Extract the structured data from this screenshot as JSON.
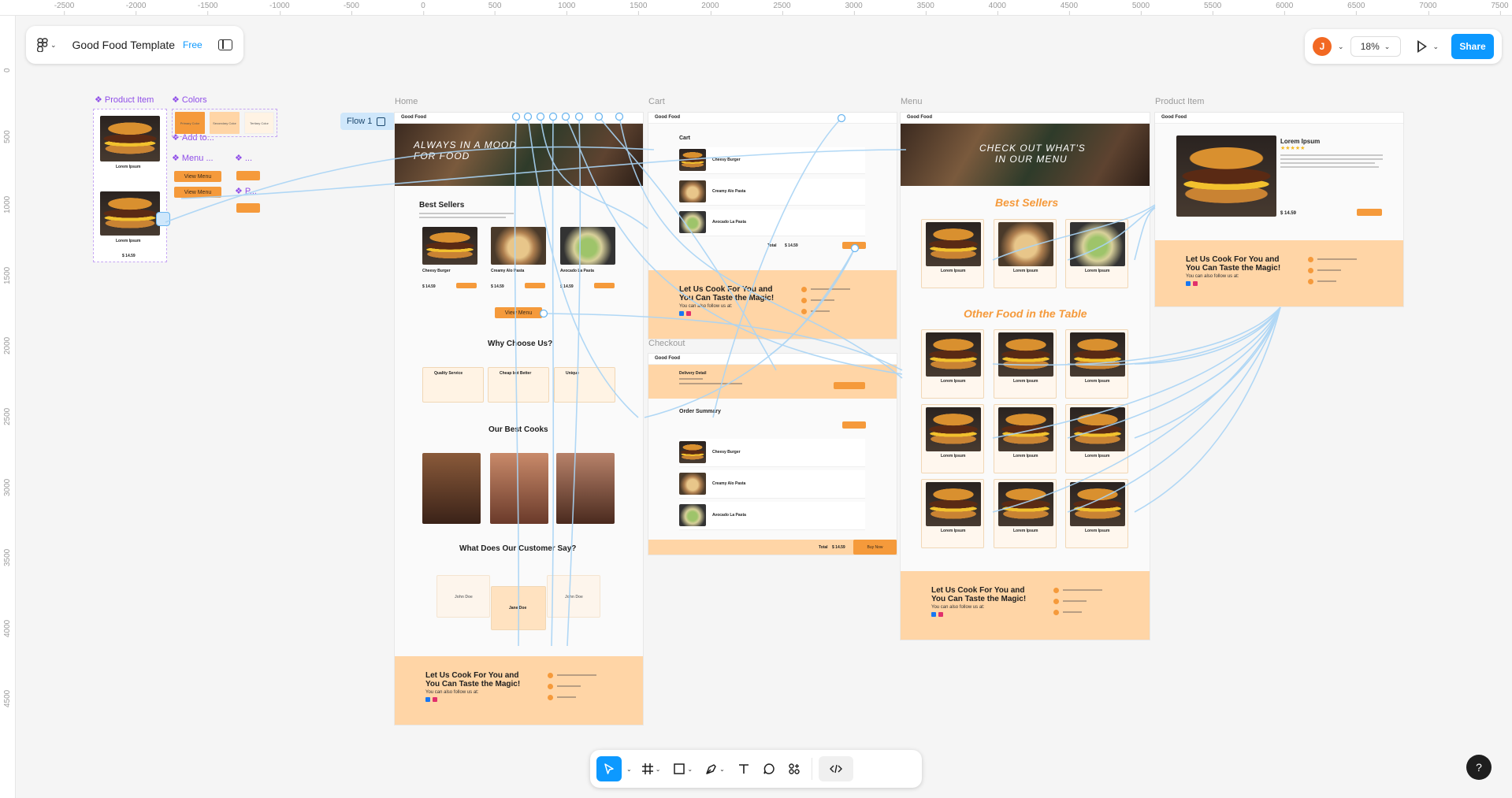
{
  "rulers": {
    "top": [
      "-2500",
      "-2000",
      "-1500",
      "-1000",
      "-500",
      "0",
      "500",
      "1000",
      "1500",
      "2000",
      "2500",
      "3000",
      "3500",
      "4000",
      "4500",
      "5000",
      "5500",
      "6000",
      "6500",
      "7000",
      "7500"
    ],
    "left": [
      "0",
      "500",
      "1000",
      "1500",
      "2000",
      "2500",
      "3000",
      "3500",
      "4000",
      "4500"
    ]
  },
  "file": {
    "title": "Good Food Template",
    "plan_badge": "Free"
  },
  "user": {
    "initial": "J"
  },
  "zoom": {
    "label": "18%"
  },
  "share": {
    "label": "Share"
  },
  "flow": {
    "label": "Flow 1"
  },
  "components": {
    "product_item": "Product Item",
    "colors": "Colors",
    "add_to": "Add to...",
    "menu": "Menu ...",
    "more": "...",
    "p": "P...",
    "swatches": [
      "Primary Color",
      "Secondary Color",
      "Tertiary Color"
    ],
    "view_menu_1": "View Menu",
    "view_menu_2": "View Menu",
    "lorem": "Lorem Ipsum",
    "price": "$ 14.59"
  },
  "frames": {
    "home": {
      "label": "Home",
      "brand": "Good Food",
      "hero_line1": "ALWAYS IN A MOOD",
      "hero_line2": "FOR FOOD",
      "best_sellers": "Best Sellers",
      "items": [
        "Cheesy Burger",
        "Creamy Alo Pasta",
        "Avocado La Pasta"
      ],
      "prices": [
        "$ 14.59",
        "$ 14.59",
        "$ 14.59"
      ],
      "view_menu": "View Menu",
      "why_title": "Why Choose Us?",
      "why_cards": [
        "Quality Service",
        "Cheap but Better",
        "Unique"
      ],
      "cooks_title": "Our Best Cooks",
      "testimonials_title": "What Does Our Customer Say?",
      "reviewers": [
        "John Doe",
        "Jane Doe",
        "John Doe"
      ],
      "cta_line1": "Let Us Cook For You and",
      "cta_line2": "You Can Taste the Magic!",
      "follow": "You can also follow us at:"
    },
    "cart": {
      "label": "Cart",
      "brand": "Good Food",
      "title": "Cart",
      "items": [
        "Cheesy Burger",
        "Creamy Alo Pasta",
        "Avocado La Pasta"
      ],
      "total_label": "Total",
      "total_value": "$ 14.59",
      "cta_line1": "Let Us Cook For You and",
      "cta_line2": "You Can Taste the Magic!",
      "follow": "You can also follow us at:"
    },
    "checkout": {
      "label": "Checkout",
      "brand": "Good Food",
      "delivery_title": "Delivery Detail",
      "order_summary": "Order Summary",
      "items": [
        "Cheesy Burger",
        "Creamy Alo Pasta",
        "Avocado La Pasta"
      ],
      "total_label": "Total",
      "total_value": "$ 14.59",
      "buy_now": "Buy Now"
    },
    "menu": {
      "label": "Menu",
      "brand": "Good Food",
      "hero_line1": "CHECK OUT WHAT'S",
      "hero_line2": "IN OUR MENU",
      "best_sellers": "Best Sellers",
      "other_food": "Other Food in the Table",
      "item_name": "Lorem Ipsum",
      "cta_line1": "Let Us Cook For You and",
      "cta_line2": "You Can Taste the Magic!",
      "follow": "You can also follow us at:"
    },
    "product": {
      "label": "Product Item",
      "brand": "Good Food",
      "name": "Lorem Ipsum",
      "stars": "★★★★★",
      "price": "$ 14.59",
      "cta_line1": "Let Us Cook For You and",
      "cta_line2": "You Can Taste the Magic!",
      "follow": "You can also follow us at:"
    }
  },
  "toolbar": {
    "tools": [
      "move-tool",
      "frame-tool",
      "shape-tool",
      "pen-tool",
      "text-tool",
      "comment-tool",
      "actions-tool",
      "dev-mode-toggle"
    ]
  },
  "help": {
    "label": "?"
  },
  "colors": {
    "accent": "#0d99ff",
    "brand_orange": "#f59a3b",
    "cta_band": "#ffd5a6",
    "component_purple": "#8f4ee8"
  }
}
